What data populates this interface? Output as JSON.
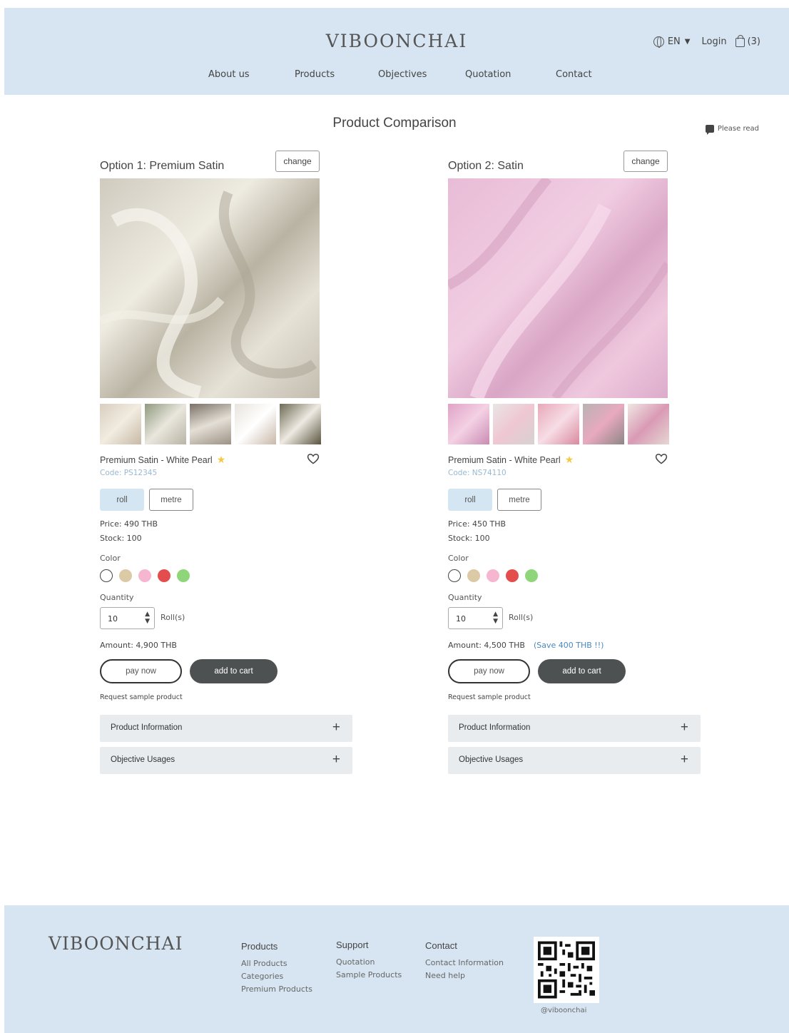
{
  "header": {
    "logo": "VIBOONCHAI",
    "language": "EN",
    "login": "Login",
    "cart_count": "(3)",
    "nav": [
      "About us",
      "Products",
      "Objectives",
      "Quotation",
      "Contact"
    ]
  },
  "page": {
    "title": "Product Comparison",
    "please_read": "Please read"
  },
  "options": [
    {
      "title": "Option 1: Premium Satin",
      "change_label": "change",
      "product_name": "Premium Satin - White Pearl",
      "code": "Code: PS12345",
      "unit_roll": "roll",
      "unit_metre": "metre",
      "price": "Price: 490 THB",
      "stock": "Stock: 100",
      "color_label": "Color",
      "quantity_label": "Quantity",
      "quantity": "10",
      "quantity_unit": "Roll(s)",
      "amount": "Amount: 4,900 THB",
      "save_note": "",
      "pay_now": "pay now",
      "add_to_cart": "add to cart",
      "request_sample": "Request sample product",
      "accordion": [
        "Product Information",
        "Objective Usages"
      ]
    },
    {
      "title": "Option 2: Satin",
      "change_label": "change",
      "product_name": "Premium Satin - White Pearl",
      "code": "Code: NS74110",
      "unit_roll": "roll",
      "unit_metre": "metre",
      "price": "Price: 450 THB",
      "stock": "Stock: 100",
      "color_label": "Color",
      "quantity_label": "Quantity",
      "quantity": "10",
      "quantity_unit": "Roll(s)",
      "amount": "Amount: 4,500 THB",
      "save_note": "(Save 400 THB !!)",
      "pay_now": "pay now",
      "add_to_cart": "add to cart",
      "request_sample": "Request sample product",
      "accordion": [
        "Product Information",
        "Objective Usages"
      ]
    }
  ],
  "swatch_colors": [
    "#ffffff",
    "#dcc9a6",
    "#f7b6d0",
    "#e44d4d",
    "#8fd67a"
  ],
  "footer": {
    "logo": "VIBOONCHAI",
    "products_heading": "Products",
    "products_links": [
      "All Products",
      "Categories",
      "Premium Products"
    ],
    "support_heading": "Support",
    "support_links": [
      "Quotation",
      "Sample Products"
    ],
    "contact_heading": "Contact",
    "contact_links": [
      "Contact Information",
      "Need help"
    ],
    "handle": "@viboonchai"
  }
}
